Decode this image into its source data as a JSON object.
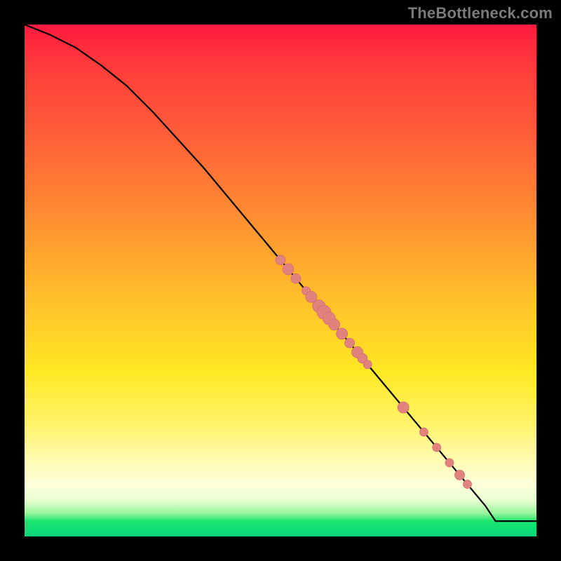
{
  "watermark": "TheBottleneck.com",
  "colors": {
    "point": "#e0827e",
    "curve": "#000000"
  },
  "chart_data": {
    "type": "line",
    "title": "",
    "xlabel": "",
    "ylabel": "",
    "xlim": [
      0,
      100
    ],
    "ylim": [
      0,
      100
    ],
    "grid": false,
    "legend": false,
    "annotations": [
      "TheBottleneck.com"
    ],
    "series": [
      {
        "name": "curve",
        "x": [
          0,
          5,
          10,
          15,
          20,
          25,
          30,
          35,
          40,
          45,
          50,
          55,
          60,
          65,
          70,
          75,
          80,
          85,
          90,
          92,
          95,
          100
        ],
        "y": [
          100,
          98,
          95.5,
          92,
          88,
          83,
          77.5,
          72,
          66,
          60,
          54,
          48,
          42,
          36,
          30,
          24,
          18,
          12,
          6,
          3,
          3,
          3
        ]
      }
    ],
    "points": [
      {
        "x": 50,
        "y": 54,
        "r": 7
      },
      {
        "x": 51.5,
        "y": 52.2,
        "r": 8
      },
      {
        "x": 53,
        "y": 50.4,
        "r": 7
      },
      {
        "x": 55,
        "y": 48,
        "r": 6
      },
      {
        "x": 56,
        "y": 46.8,
        "r": 8
      },
      {
        "x": 57.5,
        "y": 45,
        "r": 9
      },
      {
        "x": 58.5,
        "y": 43.8,
        "r": 10
      },
      {
        "x": 59.5,
        "y": 42.6,
        "r": 9
      },
      {
        "x": 60.5,
        "y": 41.4,
        "r": 8
      },
      {
        "x": 62,
        "y": 39.6,
        "r": 8
      },
      {
        "x": 63.5,
        "y": 37.8,
        "r": 7
      },
      {
        "x": 65,
        "y": 36,
        "r": 8
      },
      {
        "x": 66,
        "y": 34.8,
        "r": 7
      },
      {
        "x": 67,
        "y": 33.6,
        "r": 6
      },
      {
        "x": 74,
        "y": 25.2,
        "r": 8
      },
      {
        "x": 78,
        "y": 20.4,
        "r": 6
      },
      {
        "x": 80.5,
        "y": 17.4,
        "r": 6
      },
      {
        "x": 83,
        "y": 14.4,
        "r": 6
      },
      {
        "x": 85,
        "y": 12,
        "r": 7
      },
      {
        "x": 86.5,
        "y": 10.2,
        "r": 6
      }
    ]
  }
}
